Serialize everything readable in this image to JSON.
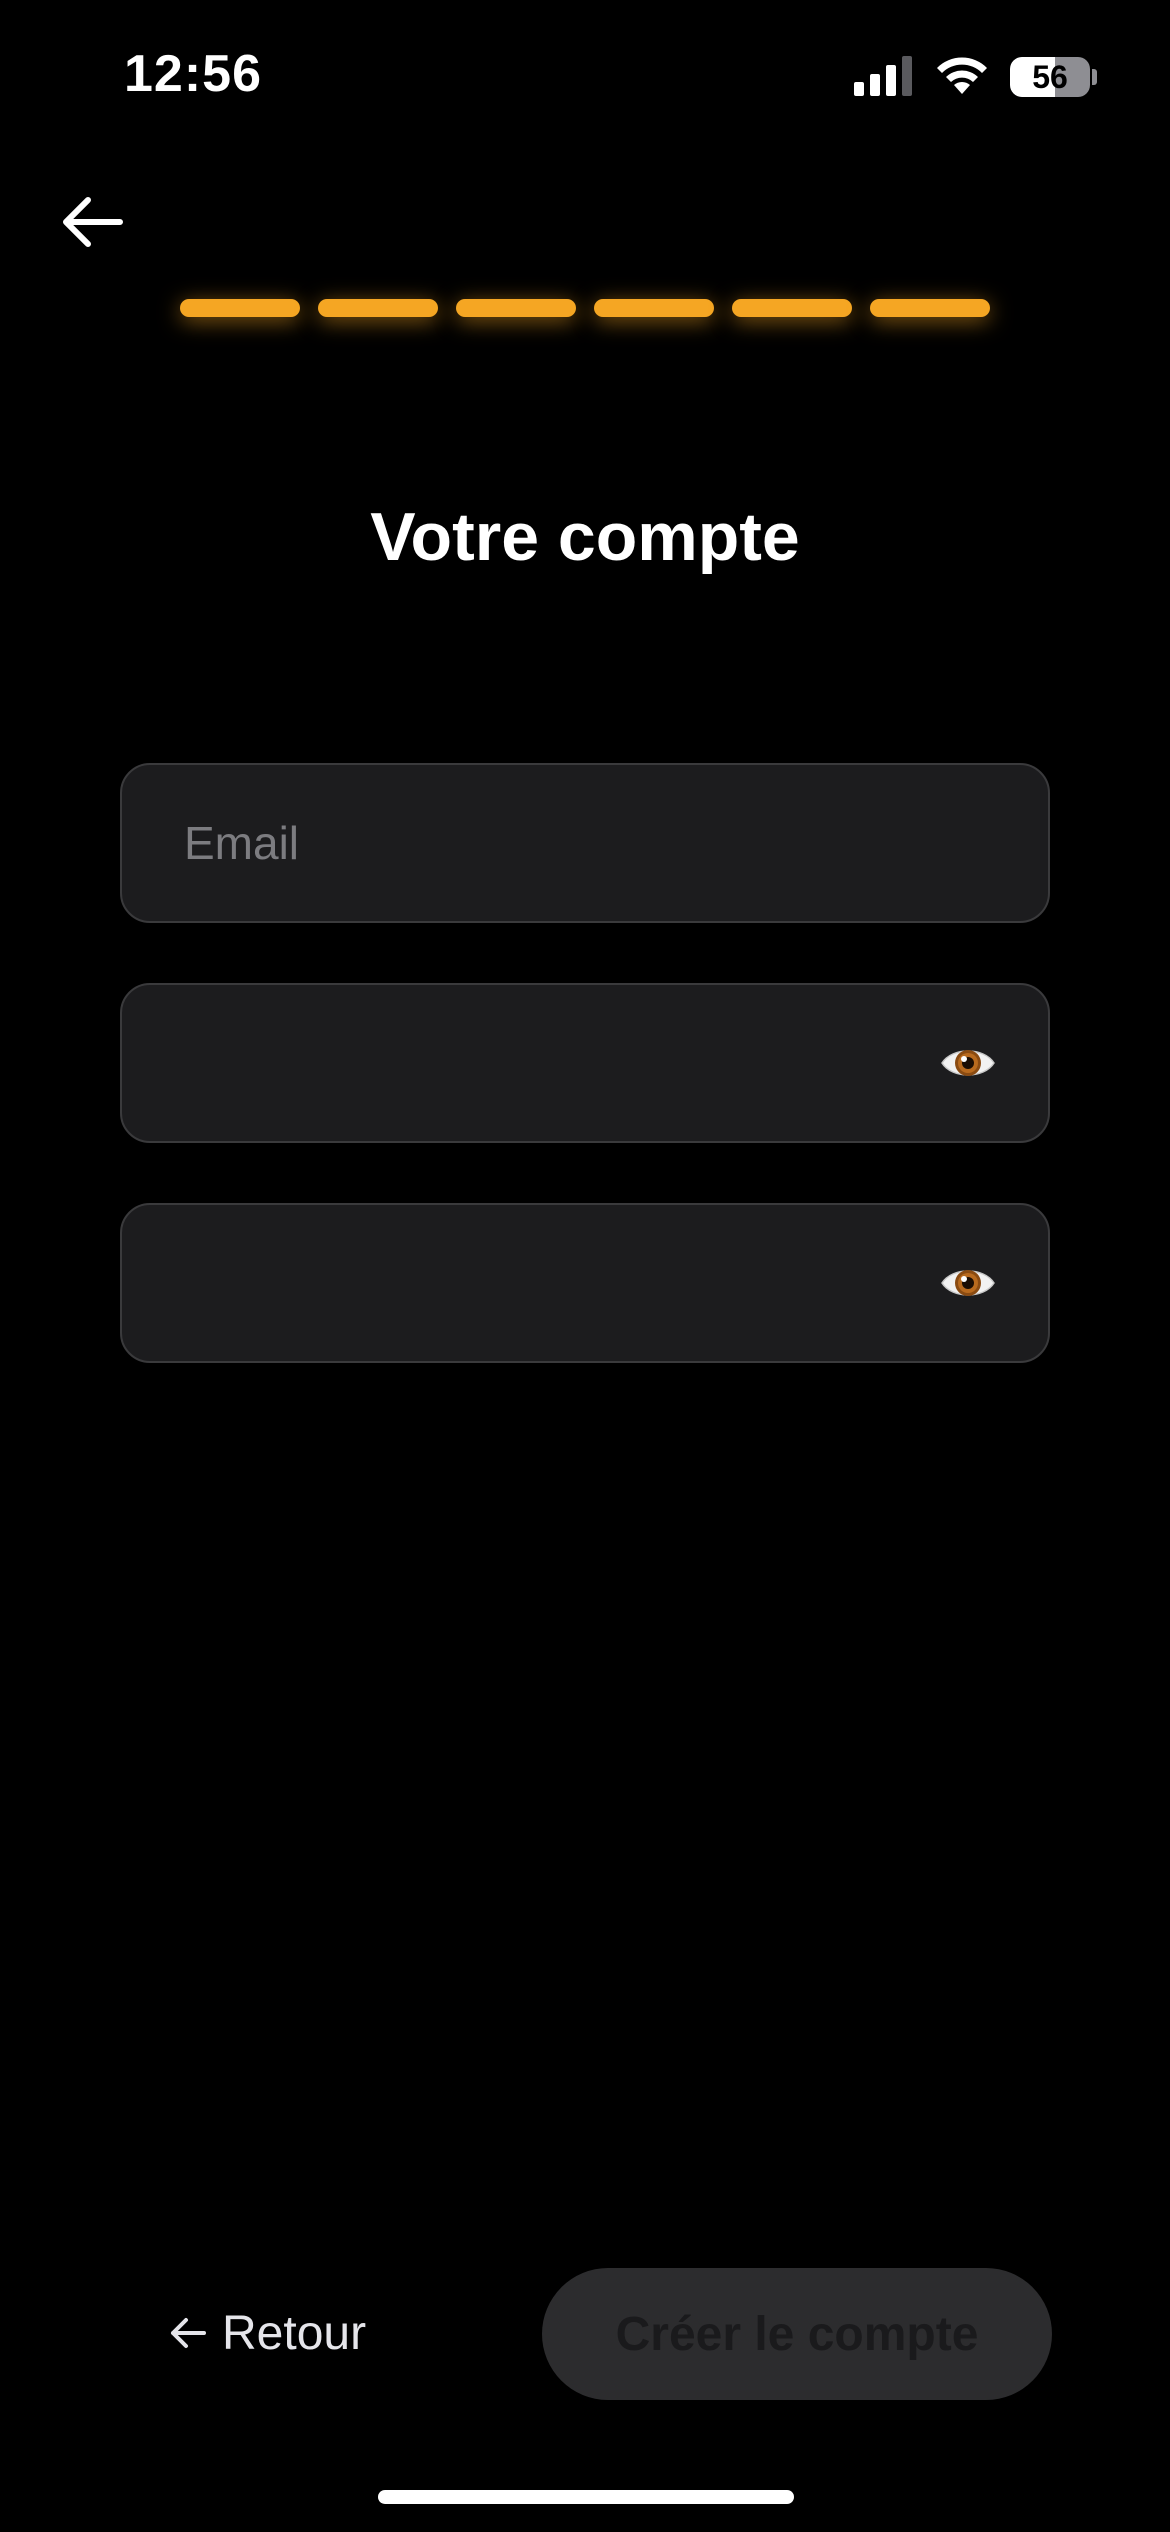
{
  "status_bar": {
    "time": "12:56",
    "battery_level": "56",
    "battery_fraction": 0.56
  },
  "progress": {
    "total_steps": 6,
    "completed_steps": 6,
    "color": "#f5a623"
  },
  "title": "Votre compte",
  "form": {
    "email": {
      "placeholder": "Email",
      "value": ""
    },
    "password": {
      "placeholder": "",
      "value": "",
      "toggle_icon": "eye-icon"
    },
    "password_confirm": {
      "placeholder": "",
      "value": "",
      "toggle_icon": "eye-icon"
    }
  },
  "actions": {
    "back_label": "Retour",
    "create_label": "Créer le compte"
  },
  "colors": {
    "background": "#000000",
    "accent": "#f5a623",
    "field_background": "#1c1c1e",
    "button_disabled": "#2c2c2e"
  }
}
